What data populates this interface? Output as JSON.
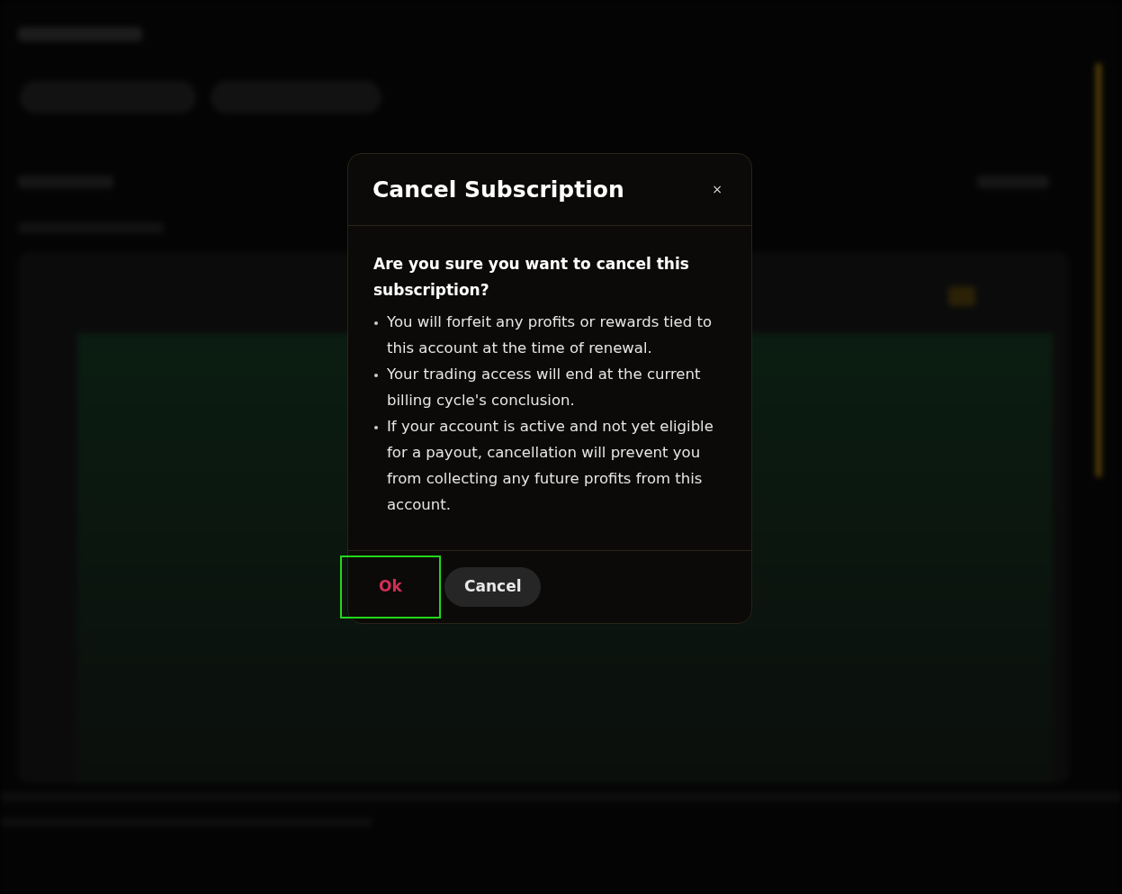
{
  "dialog": {
    "title": "Cancel Subscription",
    "close_label": "×",
    "question": "Are you sure you want to cancel this subscription?",
    "points": [
      "You will forfeit any profits or rewards tied to this account at the time of renewal.",
      "Your trading access will end at the current billing cycle's conclusion.",
      "If your account is active and not yet eligible for a payout, cancellation will prevent you from collecting any future profits from this account."
    ],
    "buttons": [
      {
        "label": "Ok",
        "kind": "danger",
        "highlighted": true
      },
      {
        "label": "Cancel",
        "kind": "secondary",
        "highlighted": false
      }
    ]
  }
}
